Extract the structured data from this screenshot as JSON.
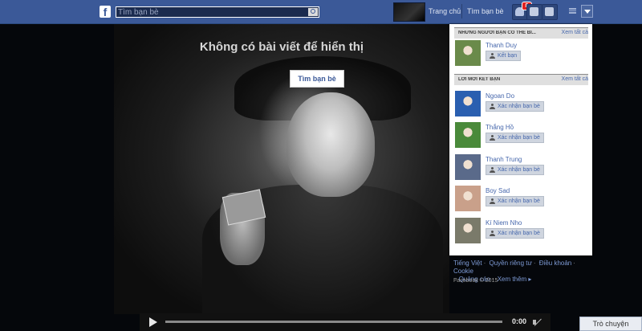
{
  "header": {
    "logo_letter": "f",
    "search_placeholder": "Tìm bạn bè",
    "nav": [
      "Trang chủ",
      "Tìm bạn bè"
    ],
    "notification_count": "8"
  },
  "feed": {
    "empty_message": "Không có bài viết để hiển thị",
    "find_friends_button": "Tìm bạn bè"
  },
  "video": {
    "time": "0:00"
  },
  "suggestions": {
    "title": "NHỮNG NGƯỜI BẠN CÓ THỂ BI...",
    "see_all": "Xem tất cả",
    "items": [
      {
        "name": "Thanh Duy",
        "action": "Kết bạn",
        "avatar_color": "#6a8a4a"
      }
    ]
  },
  "requests": {
    "title": "LỜI MỜI KẾT BẠN",
    "see_all": "Xem tất cả",
    "items": [
      {
        "name": "Ngoan Do",
        "action": "Xác nhận bạn bè",
        "avatar_color": "#2a5fb0"
      },
      {
        "name": "Thắng Hồ",
        "action": "Xác nhận bạn bè",
        "avatar_color": "#4a8a3a"
      },
      {
        "name": "Thanh Trung",
        "action": "Xác nhận bạn bè",
        "avatar_color": "#5a6a8a"
      },
      {
        "name": "Boy Sad",
        "action": "Xác nhận bạn bè",
        "avatar_color": "#c9a08a"
      },
      {
        "name": "Kí Niem Nho",
        "action": "Xác nhận bạn bè",
        "avatar_color": "#7a7a6a"
      }
    ]
  },
  "footer": {
    "links": [
      "Tiếng Việt",
      "Quyền riêng tư",
      "Điều khoản",
      "Cookie",
      "Quảng cáo",
      "Xem thêm ▸"
    ],
    "copyright": "Facebook © 2015"
  },
  "chat": {
    "label": "Trò chuyện"
  }
}
